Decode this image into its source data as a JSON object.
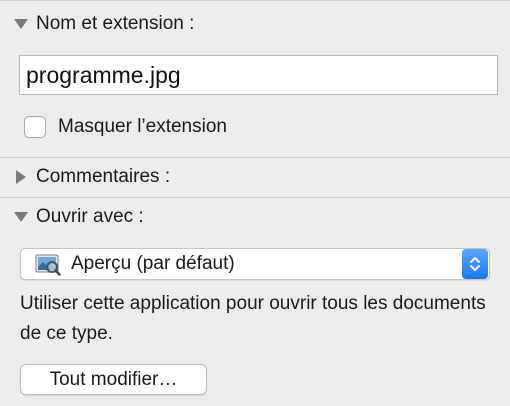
{
  "sections": {
    "name_extension": {
      "title": "Nom et extension :",
      "expanded": true,
      "filename": "programme.jpg",
      "hide_extension_label": "Masquer l’extension",
      "hide_extension_checked": false
    },
    "comments": {
      "title": "Commentaires :",
      "expanded": false
    },
    "open_with": {
      "title": "Ouvrir avec :",
      "expanded": true,
      "app_label": "Aperçu (par défaut)",
      "app_icon": "preview-app-icon",
      "description": "Utiliser cette application pour ouvrir tous les documents de ce type.",
      "change_all_label": "Tout modifier…"
    }
  },
  "colors": {
    "background": "#ececec",
    "accent": "#1d78f0"
  }
}
